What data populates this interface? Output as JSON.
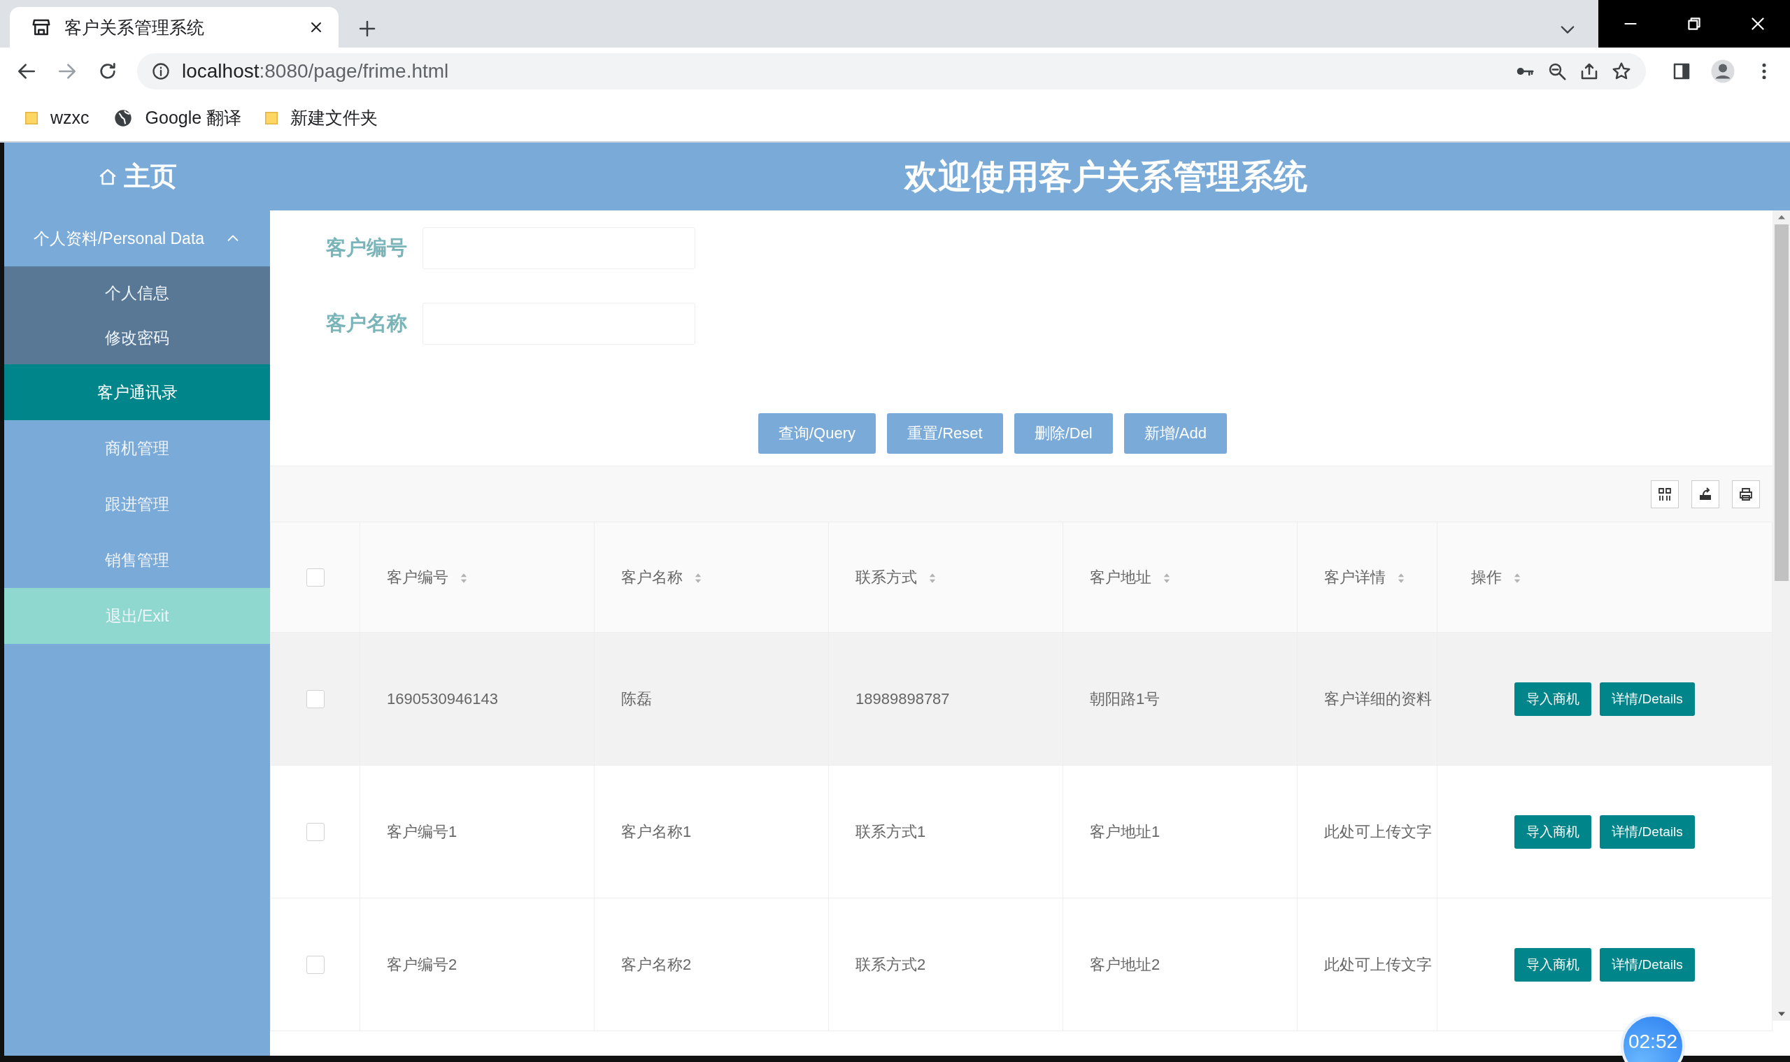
{
  "browser": {
    "tab_title": "客户关系管理系统",
    "url_host": "localhost",
    "url_path": ":8080/page/frime.html",
    "bookmarks": [
      {
        "kind": "folder",
        "label": "wzxc"
      },
      {
        "kind": "globe",
        "label": "Google 翻译"
      },
      {
        "kind": "folder",
        "label": "新建文件夹"
      }
    ]
  },
  "header": {
    "home": "主页",
    "title": "欢迎使用客户关系管理系统"
  },
  "sidebar": {
    "items": [
      {
        "kind": "group",
        "label": "个人资料/Personal Data",
        "expanded": true,
        "selected": false,
        "children": [
          {
            "label": "个人信息",
            "selected": false
          },
          {
            "label": "修改密码",
            "selected": false
          }
        ]
      },
      {
        "kind": "link",
        "label": "客户通讯录",
        "selected": true
      },
      {
        "kind": "link",
        "label": "商机管理",
        "selected": false
      },
      {
        "kind": "link",
        "label": "跟进管理",
        "selected": false
      },
      {
        "kind": "link",
        "label": "销售管理",
        "selected": false
      },
      {
        "kind": "exit",
        "label": "退出/Exit",
        "selected": false
      }
    ]
  },
  "search_form": {
    "fields": [
      {
        "label": "客户编号"
      },
      {
        "label": "客户名称"
      }
    ],
    "buttons": [
      "查询/Query",
      "重置/Reset",
      "删除/Del",
      "新增/Add"
    ]
  },
  "table": {
    "columns": [
      "客户编号",
      "客户名称",
      "联系方式",
      "客户地址",
      "客户详情",
      "操作"
    ],
    "header_checked": false,
    "rows": [
      {
        "checked": false,
        "hovered": true,
        "cells": [
          "1690530946143",
          "陈磊",
          "18989898787",
          "朝阳路1号",
          "客户详细的资料"
        ],
        "actions": [
          "导入商机",
          "详情/Details"
        ]
      },
      {
        "checked": false,
        "hovered": false,
        "cells": [
          "客户编号1",
          "客户名称1",
          "联系方式1",
          "客户地址1",
          "此处可上传文字"
        ],
        "actions": [
          "导入商机",
          "详情/Details"
        ]
      },
      {
        "checked": false,
        "hovered": false,
        "cells": [
          "客户编号2",
          "客户名称2",
          "联系方式2",
          "客户地址2",
          "此处可上传文字"
        ],
        "actions": [
          "导入商机",
          "详情/Details"
        ]
      }
    ]
  },
  "recorder_timer": "02:52"
}
